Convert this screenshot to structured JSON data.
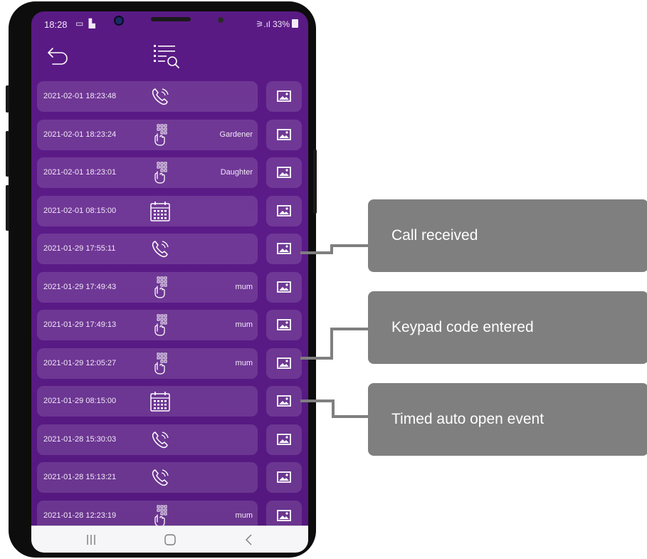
{
  "status_bar": {
    "time": "18:28",
    "notifications": "▭ ▙",
    "signal": "⚞.ıl",
    "battery": "33%"
  },
  "toolbar": {
    "back_icon": "back-arrow-icon",
    "filter_icon": "list-search-icon"
  },
  "events": [
    {
      "datetime": "2021-02-01 18:23:48",
      "type": "call",
      "name": ""
    },
    {
      "datetime": "2021-02-01 18:23:24",
      "type": "keypad",
      "name": "Gardener"
    },
    {
      "datetime": "2021-02-01 18:23:01",
      "type": "keypad",
      "name": "Daughter"
    },
    {
      "datetime": "2021-02-01 08:15:00",
      "type": "timed",
      "name": ""
    },
    {
      "datetime": "2021-01-29 17:55:11",
      "type": "call",
      "name": ""
    },
    {
      "datetime": "2021-01-29 17:49:43",
      "type": "keypad",
      "name": "mum"
    },
    {
      "datetime": "2021-01-29 17:49:13",
      "type": "keypad",
      "name": "mum"
    },
    {
      "datetime": "2021-01-29 12:05:27",
      "type": "keypad",
      "name": "mum"
    },
    {
      "datetime": "2021-01-29 08:15:00",
      "type": "timed",
      "name": ""
    },
    {
      "datetime": "2021-01-28 15:30:03",
      "type": "call",
      "name": ""
    },
    {
      "datetime": "2021-01-28 15:13:21",
      "type": "call",
      "name": ""
    },
    {
      "datetime": "2021-01-28 12:23:19",
      "type": "keypad",
      "name": "mum"
    }
  ],
  "callouts": [
    {
      "label": "Call received"
    },
    {
      "label": "Keypad code entered"
    },
    {
      "label": "Timed auto open event"
    }
  ],
  "colors": {
    "screen_bg": "#5a1a84",
    "row_bg": "#7d4aa2",
    "callout_bg": "#7f7f7f",
    "text": "#f2e8f8"
  }
}
